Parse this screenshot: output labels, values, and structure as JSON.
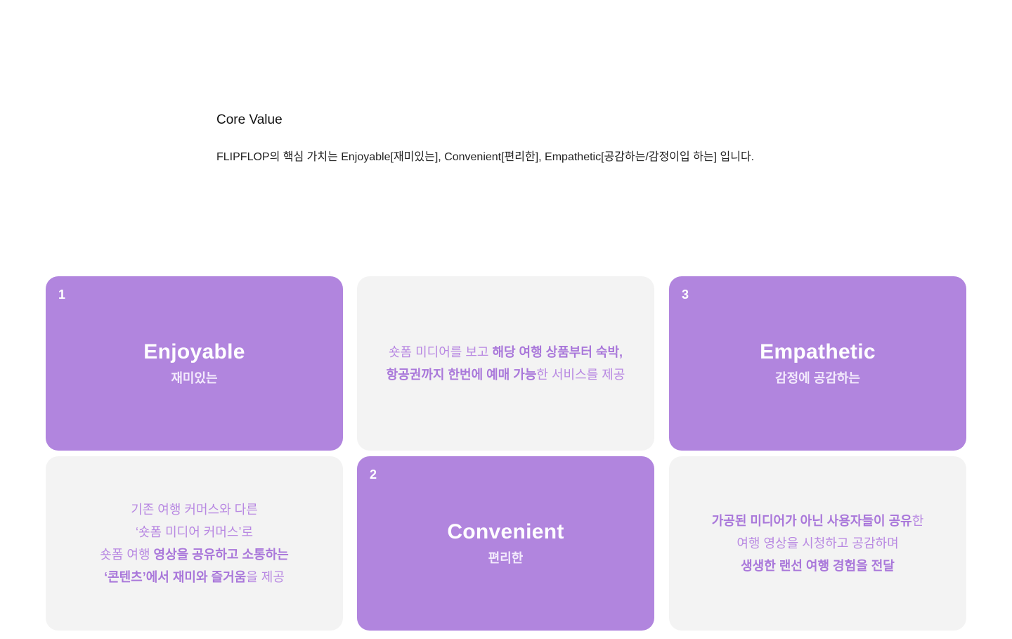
{
  "section": {
    "title": "Core Value",
    "description": "FLIPFLOP의 핵심 가치는 Enjoyable[재미있는], Convenient[편리한], Empathetic[공감하는/감정이입 하는] 입니다."
  },
  "colors": {
    "accent": "#b185de",
    "card_gray": "#f3f3f3"
  },
  "value_cards": [
    {
      "number": "1",
      "title": "Enjoyable",
      "subtitle": "재미있는"
    },
    {
      "number": "3",
      "title": "Empathetic",
      "subtitle": "감정에 공감하는"
    },
    {
      "number": "2",
      "title": "Convenient",
      "subtitle": "편리한"
    }
  ],
  "text_cards": {
    "convenient": {
      "l1_a": "숏폼 미디어를 보고 ",
      "l1_b": "해당 여행 상품부터 숙박,",
      "l2_a": "항공권까지 한번에 예매 가능",
      "l2_b": "한 서비스를 제공"
    },
    "enjoyable": {
      "l1": "기존 여행 커머스와 다른",
      "l2": "‘숏폼 미디어 커머스’로",
      "l3_a": "숏폼 여행 ",
      "l3_b": "영상을 공유하고 소통하는",
      "l4_a": "‘콘텐츠’에서 재미와 즐거움",
      "l4_b": "을 제공"
    },
    "empathetic": {
      "l1_a": "가공된 미디어가 아닌 사용자들이 공유",
      "l1_b": "한",
      "l2": "여행 영상을 시청하고 공감하며",
      "l3": "생생한 랜선 여행 경험을 전달"
    }
  }
}
